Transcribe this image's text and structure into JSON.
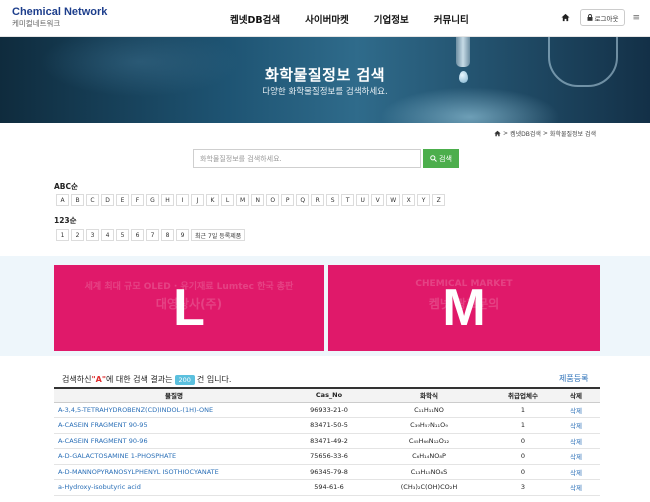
{
  "header": {
    "logo_title": "Chemical Network",
    "logo_sub": "케미컬네트워크",
    "nav": [
      "켐넷DB검색",
      "사이버마켓",
      "기업정보",
      "커뮤니티"
    ],
    "login_label": "로그아웃"
  },
  "banner": {
    "title": "화학물질정보 검색",
    "subtitle": "다양한 화학물질정보를 검색하세요."
  },
  "breadcrumb": [
    "켐넷DB검색",
    "화학물질정보 검색"
  ],
  "search": {
    "placeholder": "화학물질정보를 검색하세요.",
    "button_label": "검색"
  },
  "index": {
    "abc_label": "ABC순",
    "abc": [
      "A",
      "B",
      "C",
      "D",
      "E",
      "F",
      "G",
      "H",
      "I",
      "J",
      "K",
      "L",
      "M",
      "N",
      "O",
      "P",
      "Q",
      "R",
      "S",
      "T",
      "U",
      "V",
      "W",
      "X",
      "Y",
      "Z"
    ],
    "num_label": "123순",
    "nums": [
      "1",
      "2",
      "3",
      "4",
      "5",
      "6",
      "7",
      "8",
      "9",
      "최근 7일 등록제품"
    ]
  },
  "ads": [
    {
      "letter": "L",
      "text1": "세계 최대 규모 OLED · 유기재료 Lumtec 한국 총판",
      "text2": "대영상사(주)"
    },
    {
      "letter": "M",
      "text1": "CHEMICAL MARKET",
      "text2": "켐넷 광고문의"
    }
  ],
  "results": {
    "prefix": "검색하신 ",
    "query": "\"A\"",
    "middle": "에 대한 검색 결과는 ",
    "count": "200",
    "suffix": "건 입니다.",
    "register_label": "제품등록",
    "columns": [
      "물질명",
      "Cas_No",
      "화학식",
      "취급업체수",
      "삭제"
    ],
    "rows": [
      {
        "name": "A-3,4,5-TETRAHYDROBENZ(CD)INDOL-(1H)-ONE",
        "cas": "96933-21-0",
        "formula": "C₁₁H₁₁NO",
        "count": "1",
        "del": "삭제"
      },
      {
        "name": "A-CASEIN FRAGMENT 90-95",
        "cas": "83471-50-5",
        "formula": "C₃₉H₅₇N₁₁O₉",
        "count": "1",
        "del": "삭제"
      },
      {
        "name": "A-CASEIN FRAGMENT 90-96",
        "cas": "83471-49-2",
        "formula": "C₄₅H₆₆N₁₂O₁₂",
        "count": "0",
        "del": "삭제"
      },
      {
        "name": "A-D-GALACTOSAMINE 1-PHOSPHATE",
        "cas": "75656-33-6",
        "formula": "C₆H₁₄NO₈P",
        "count": "0",
        "del": "삭제"
      },
      {
        "name": "A-D-MANNOPYRANOSYLPHENYL ISOTHIOCYANATE",
        "cas": "96345-79-8",
        "formula": "C₁₃H₁₅NO₆S",
        "count": "0",
        "del": "삭제"
      },
      {
        "name": "a-Hydroxy-isobutyric acid",
        "cas": "594-61-6",
        "formula": "(CH₃)₂C(OH)CO₂H",
        "count": "3",
        "del": "삭제"
      }
    ]
  }
}
